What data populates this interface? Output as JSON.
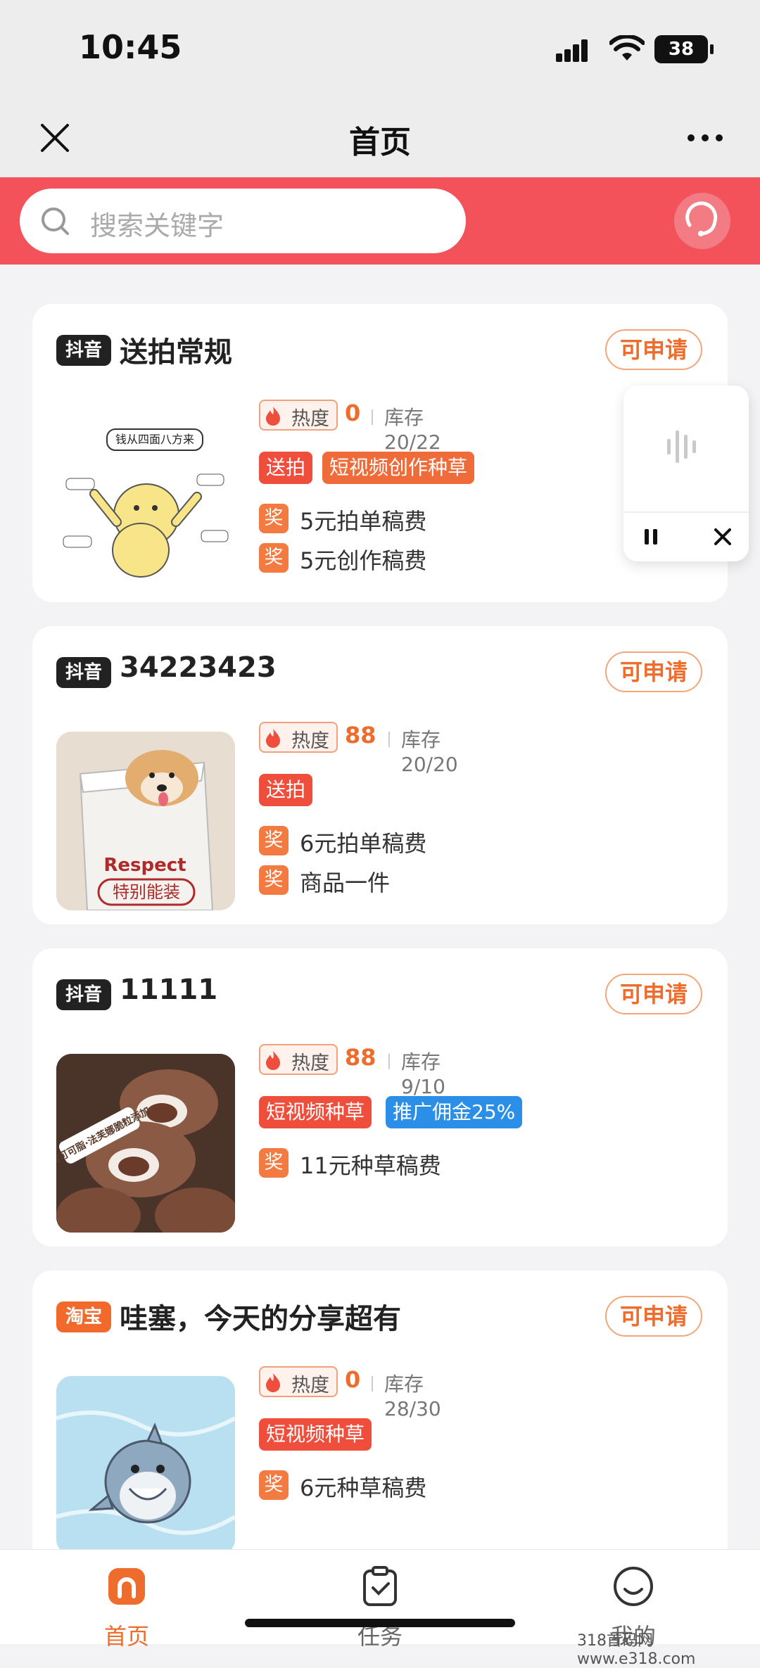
{
  "status": {
    "time": "10:45",
    "battery": "38"
  },
  "nav": {
    "title": "首页"
  },
  "search": {
    "placeholder": "搜索关键字"
  },
  "cards": [
    {
      "platform": "抖音",
      "title": "送拍常规",
      "apply": "可申请",
      "heat_label": "热度",
      "heat": "0",
      "stock": "库存20/22",
      "tags": [
        "送拍",
        "短视频创作种草"
      ],
      "rewards": [
        "5元拍单稿费",
        "5元创作稿费"
      ],
      "thumb_text": "钱从四面八方来"
    },
    {
      "platform": "抖音",
      "title": "34223423",
      "apply": "可申请",
      "heat_label": "热度",
      "heat": "88",
      "stock": "库存20/20",
      "tags": [
        "送拍"
      ],
      "rewards": [
        "6元拍单稿费",
        "商品一件"
      ],
      "thumb_text": "Respect",
      "thumb_text2": "特别能装"
    },
    {
      "platform": "抖音",
      "title": "11111",
      "apply": "可申请",
      "heat_label": "热度",
      "heat": "88",
      "stock": "库存9/10",
      "tags": [
        "短视频种草",
        "推广佣金25%"
      ],
      "rewards": [
        "11元种草稿费"
      ],
      "thumb_text": "纯可可脂·法芙娜脆粒添加"
    },
    {
      "platform": "淘宝",
      "title": "哇塞，今天的分享超有",
      "apply": "可申请",
      "heat_label": "热度",
      "heat": "0",
      "stock": "库存28/30",
      "tags": [
        "短视频种草"
      ],
      "rewards": [
        "6元种草稿费"
      ]
    }
  ],
  "reward_badge": "奖",
  "tabs": [
    {
      "label": "首页"
    },
    {
      "label": "任务"
    },
    {
      "label": "我的"
    }
  ],
  "watermark": "318首码网 www.e318.com",
  "colors": {
    "accent": "#f3525a",
    "orange": "#ee6d2c",
    "douyin": "#222222",
    "taobao": "#f26a2b",
    "blue": "#2b8fe8"
  }
}
